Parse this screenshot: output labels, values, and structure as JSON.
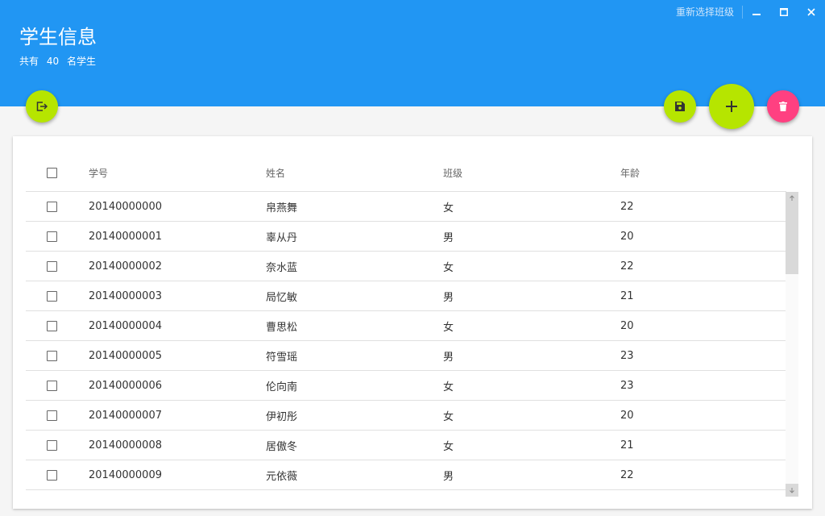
{
  "header": {
    "title": "学生信息",
    "count_prefix": "共有",
    "count": "40",
    "count_suffix": "名学生",
    "reselect_label": "重新选择班级",
    "bg_color": "#2196f3"
  },
  "window_controls": {
    "minimize_icon": "minimize-icon",
    "maximize_icon": "maximize-icon",
    "close_icon": "close-icon"
  },
  "actions": {
    "export_icon": "exit-icon",
    "save_icon": "save-icon",
    "add_icon": "plus-icon",
    "delete_icon": "trash-icon",
    "green": "#b6e500",
    "pink": "#ff4081"
  },
  "table": {
    "columns": [
      "学号",
      "姓名",
      "班级",
      "年龄"
    ],
    "rows": [
      {
        "id": "20140000000",
        "name": "帛燕舞",
        "class": "女",
        "age": "22"
      },
      {
        "id": "20140000001",
        "name": "辜从丹",
        "class": "男",
        "age": "20"
      },
      {
        "id": "20140000002",
        "name": "奈水蓝",
        "class": "女",
        "age": "22"
      },
      {
        "id": "20140000003",
        "name": "局忆敏",
        "class": "男",
        "age": "21"
      },
      {
        "id": "20140000004",
        "name": "曹思松",
        "class": "女",
        "age": "20"
      },
      {
        "id": "20140000005",
        "name": "符雪瑶",
        "class": "男",
        "age": "23"
      },
      {
        "id": "20140000006",
        "name": "伦向南",
        "class": "女",
        "age": "23"
      },
      {
        "id": "20140000007",
        "name": "伊初彤",
        "class": "女",
        "age": "20"
      },
      {
        "id": "20140000008",
        "name": "居傲冬",
        "class": "女",
        "age": "21"
      },
      {
        "id": "20140000009",
        "name": "元依薇",
        "class": "男",
        "age": "22"
      }
    ]
  }
}
